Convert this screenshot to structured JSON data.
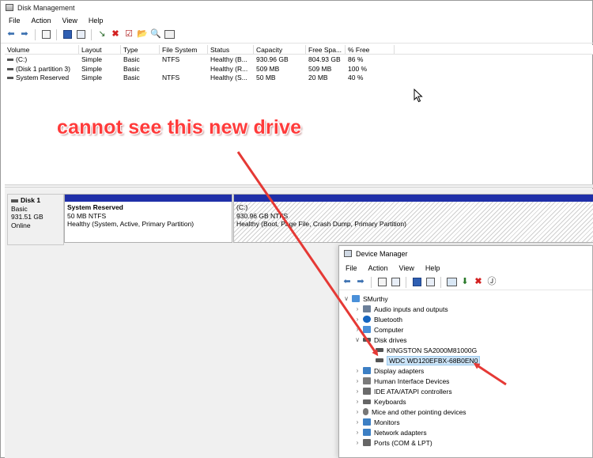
{
  "disk_management": {
    "title": "Disk Management",
    "menu": [
      "File",
      "Action",
      "View",
      "Help"
    ],
    "columns": [
      "Volume",
      "Layout",
      "Type",
      "File System",
      "Status",
      "Capacity",
      "Free Spa...",
      "% Free"
    ],
    "volumes": [
      [
        "(C:)",
        "Simple",
        "Basic",
        "NTFS",
        "Healthy (B...",
        "930.96 GB",
        "804.93 GB",
        "86 %"
      ],
      [
        "(Disk 1 partition 3)",
        "Simple",
        "Basic",
        "",
        "Healthy (R...",
        "509 MB",
        "509 MB",
        "100 %"
      ],
      [
        "System Reserved",
        "Simple",
        "Basic",
        "NTFS",
        "Healthy (S...",
        "50 MB",
        "20 MB",
        "40 %"
      ]
    ],
    "disk": {
      "name": "Disk 1",
      "type": "Basic",
      "size": "931.51 GB",
      "status": "Online"
    },
    "partitions": [
      {
        "name": "System Reserved",
        "size": "50 MB NTFS",
        "status": "Healthy (System, Active, Primary Partition)"
      },
      {
        "name": "(C:)",
        "size": "930.96 GB NTFS",
        "status": "Healthy (Boot, Page File, Crash Dump, Primary Partition)"
      }
    ]
  },
  "annotation": "cannot see this new drive",
  "device_manager": {
    "title": "Device Manager",
    "menu": [
      "File",
      "Action",
      "View",
      "Help"
    ],
    "root": "SMurthy",
    "categories": [
      {
        "label": "Audio inputs and outputs",
        "icon": "speaker-icon",
        "color": "#6b7f99"
      },
      {
        "label": "Bluetooth",
        "icon": "bluetooth-icon",
        "color": "#1565c0"
      },
      {
        "label": "Computer",
        "icon": "computer-icon",
        "color": "#4a90d9"
      },
      {
        "label": "Disk drives",
        "icon": "disk-drive-icon",
        "color": "#555555",
        "expanded": true,
        "children": [
          {
            "label": "KINGSTON SA2000M81000G"
          },
          {
            "label": "WDC WD120EFBX-68B0EN0",
            "selected": true
          }
        ]
      },
      {
        "label": "Display adapters",
        "icon": "display-adapter-icon",
        "color": "#3c7fc4"
      },
      {
        "label": "Human Interface Devices",
        "icon": "hid-icon",
        "color": "#7a7a7a"
      },
      {
        "label": "IDE ATA/ATAPI controllers",
        "icon": "ide-controller-icon",
        "color": "#6a6a6a"
      },
      {
        "label": "Keyboards",
        "icon": "keyboard-icon",
        "color": "#666666"
      },
      {
        "label": "Mice and other pointing devices",
        "icon": "mouse-icon",
        "color": "#777777"
      },
      {
        "label": "Monitors",
        "icon": "monitor-icon",
        "color": "#3c7fc4"
      },
      {
        "label": "Network adapters",
        "icon": "network-adapter-icon",
        "color": "#3c7fc4"
      },
      {
        "label": "Ports (COM & LPT)",
        "icon": "port-icon",
        "color": "#666666"
      }
    ]
  },
  "colors": {
    "partition_bar": "#1f2fa8",
    "annotation": "#ff3b3b",
    "arrow": "#e53935",
    "selection": "#cce4f7"
  }
}
